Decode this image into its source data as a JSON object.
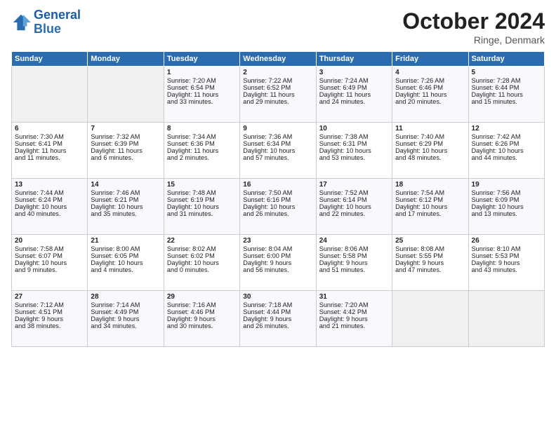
{
  "logo": {
    "line1": "General",
    "line2": "Blue"
  },
  "title": "October 2024",
  "location": "Ringe, Denmark",
  "days_of_week": [
    "Sunday",
    "Monday",
    "Tuesday",
    "Wednesday",
    "Thursday",
    "Friday",
    "Saturday"
  ],
  "weeks": [
    [
      {
        "day": "",
        "info": ""
      },
      {
        "day": "",
        "info": ""
      },
      {
        "day": "1",
        "info": "Sunrise: 7:20 AM\nSunset: 6:54 PM\nDaylight: 11 hours\nand 33 minutes."
      },
      {
        "day": "2",
        "info": "Sunrise: 7:22 AM\nSunset: 6:52 PM\nDaylight: 11 hours\nand 29 minutes."
      },
      {
        "day": "3",
        "info": "Sunrise: 7:24 AM\nSunset: 6:49 PM\nDaylight: 11 hours\nand 24 minutes."
      },
      {
        "day": "4",
        "info": "Sunrise: 7:26 AM\nSunset: 6:46 PM\nDaylight: 11 hours\nand 20 minutes."
      },
      {
        "day": "5",
        "info": "Sunrise: 7:28 AM\nSunset: 6:44 PM\nDaylight: 11 hours\nand 15 minutes."
      }
    ],
    [
      {
        "day": "6",
        "info": "Sunrise: 7:30 AM\nSunset: 6:41 PM\nDaylight: 11 hours\nand 11 minutes."
      },
      {
        "day": "7",
        "info": "Sunrise: 7:32 AM\nSunset: 6:39 PM\nDaylight: 11 hours\nand 6 minutes."
      },
      {
        "day": "8",
        "info": "Sunrise: 7:34 AM\nSunset: 6:36 PM\nDaylight: 11 hours\nand 2 minutes."
      },
      {
        "day": "9",
        "info": "Sunrise: 7:36 AM\nSunset: 6:34 PM\nDaylight: 10 hours\nand 57 minutes."
      },
      {
        "day": "10",
        "info": "Sunrise: 7:38 AM\nSunset: 6:31 PM\nDaylight: 10 hours\nand 53 minutes."
      },
      {
        "day": "11",
        "info": "Sunrise: 7:40 AM\nSunset: 6:29 PM\nDaylight: 10 hours\nand 48 minutes."
      },
      {
        "day": "12",
        "info": "Sunrise: 7:42 AM\nSunset: 6:26 PM\nDaylight: 10 hours\nand 44 minutes."
      }
    ],
    [
      {
        "day": "13",
        "info": "Sunrise: 7:44 AM\nSunset: 6:24 PM\nDaylight: 10 hours\nand 40 minutes."
      },
      {
        "day": "14",
        "info": "Sunrise: 7:46 AM\nSunset: 6:21 PM\nDaylight: 10 hours\nand 35 minutes."
      },
      {
        "day": "15",
        "info": "Sunrise: 7:48 AM\nSunset: 6:19 PM\nDaylight: 10 hours\nand 31 minutes."
      },
      {
        "day": "16",
        "info": "Sunrise: 7:50 AM\nSunset: 6:16 PM\nDaylight: 10 hours\nand 26 minutes."
      },
      {
        "day": "17",
        "info": "Sunrise: 7:52 AM\nSunset: 6:14 PM\nDaylight: 10 hours\nand 22 minutes."
      },
      {
        "day": "18",
        "info": "Sunrise: 7:54 AM\nSunset: 6:12 PM\nDaylight: 10 hours\nand 17 minutes."
      },
      {
        "day": "19",
        "info": "Sunrise: 7:56 AM\nSunset: 6:09 PM\nDaylight: 10 hours\nand 13 minutes."
      }
    ],
    [
      {
        "day": "20",
        "info": "Sunrise: 7:58 AM\nSunset: 6:07 PM\nDaylight: 10 hours\nand 9 minutes."
      },
      {
        "day": "21",
        "info": "Sunrise: 8:00 AM\nSunset: 6:05 PM\nDaylight: 10 hours\nand 4 minutes."
      },
      {
        "day": "22",
        "info": "Sunrise: 8:02 AM\nSunset: 6:02 PM\nDaylight: 10 hours\nand 0 minutes."
      },
      {
        "day": "23",
        "info": "Sunrise: 8:04 AM\nSunset: 6:00 PM\nDaylight: 9 hours\nand 56 minutes."
      },
      {
        "day": "24",
        "info": "Sunrise: 8:06 AM\nSunset: 5:58 PM\nDaylight: 9 hours\nand 51 minutes."
      },
      {
        "day": "25",
        "info": "Sunrise: 8:08 AM\nSunset: 5:55 PM\nDaylight: 9 hours\nand 47 minutes."
      },
      {
        "day": "26",
        "info": "Sunrise: 8:10 AM\nSunset: 5:53 PM\nDaylight: 9 hours\nand 43 minutes."
      }
    ],
    [
      {
        "day": "27",
        "info": "Sunrise: 7:12 AM\nSunset: 4:51 PM\nDaylight: 9 hours\nand 38 minutes."
      },
      {
        "day": "28",
        "info": "Sunrise: 7:14 AM\nSunset: 4:49 PM\nDaylight: 9 hours\nand 34 minutes."
      },
      {
        "day": "29",
        "info": "Sunrise: 7:16 AM\nSunset: 4:46 PM\nDaylight: 9 hours\nand 30 minutes."
      },
      {
        "day": "30",
        "info": "Sunrise: 7:18 AM\nSunset: 4:44 PM\nDaylight: 9 hours\nand 26 minutes."
      },
      {
        "day": "31",
        "info": "Sunrise: 7:20 AM\nSunset: 4:42 PM\nDaylight: 9 hours\nand 21 minutes."
      },
      {
        "day": "",
        "info": ""
      },
      {
        "day": "",
        "info": ""
      }
    ]
  ]
}
